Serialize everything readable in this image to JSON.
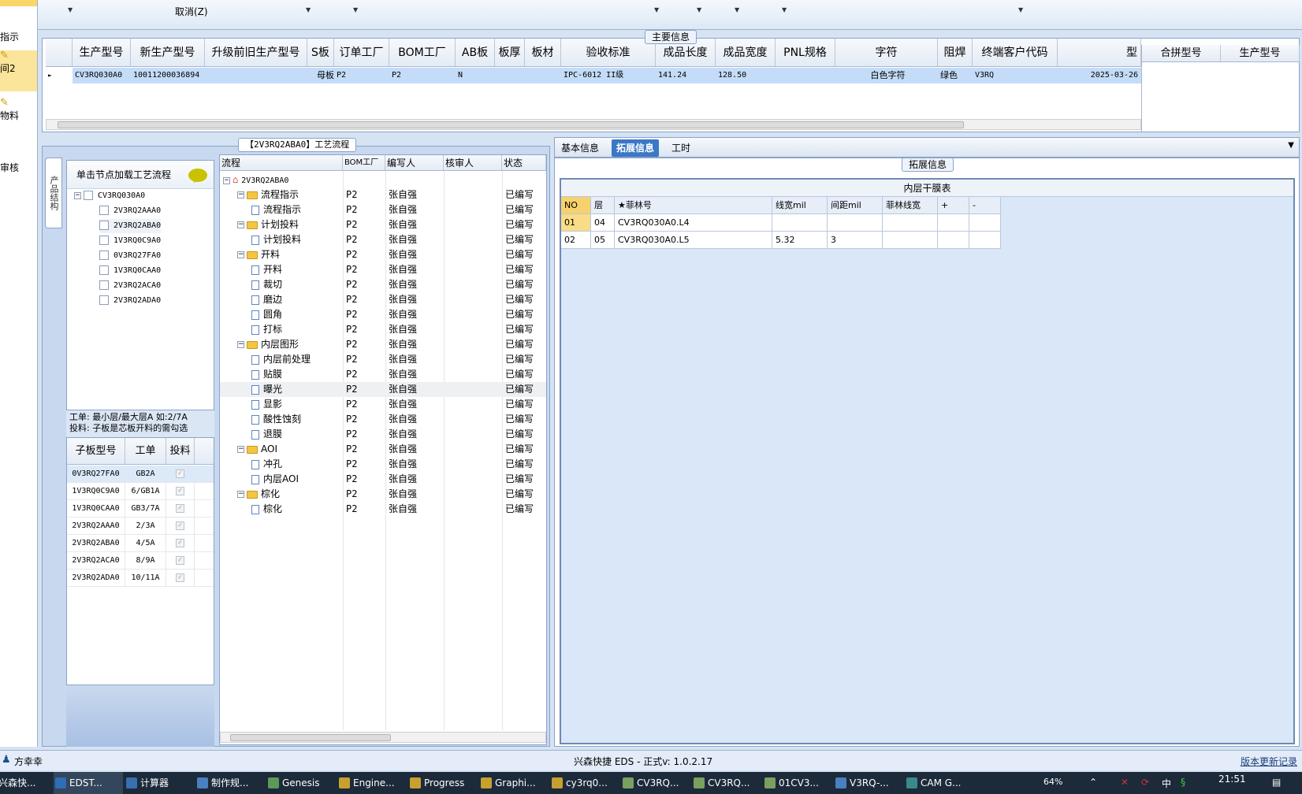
{
  "toolbar": {
    "cancel_label": "取消(Z)"
  },
  "left_nav": [
    "指示",
    "间2",
    "物料",
    "审核"
  ],
  "main_info": {
    "legend": "主要信息",
    "columns": [
      "生产型号",
      "新生产型号",
      "升级前旧生产型号",
      "S板",
      "订单工厂",
      "BOM工厂",
      "AB板",
      "板厚",
      "板材",
      "验收标准",
      "成品长度",
      "成品宽度",
      "PNL规格",
      "字符",
      "阻焊",
      "终端客户代码",
      "型"
    ],
    "row": [
      "CV3RQ030A0",
      "10011200036894",
      "",
      "母板",
      "P2",
      "P2",
      "N",
      "",
      "",
      "IPC-6012 II级",
      "141.24",
      "128.50",
      "",
      "白色字符",
      "绿色",
      "V3RQ",
      "2025-03-26"
    ],
    "side_columns": [
      "合拼型号",
      "生产型号"
    ]
  },
  "process": {
    "legend": "【2V3RQ2ABA0】工艺流程",
    "vtab": "产品结构",
    "tree_header": "单击节点加载工艺流程",
    "tree_root": "CV3RQ030A0",
    "tree_children": [
      "2V3RQ2AAA0",
      "2V3RQ2ABA0",
      "1V3RQ0C9A0",
      "0V3RQ27FA0",
      "1V3RQ0CAA0",
      "2V3RQ2ACA0",
      "2V3RQ2ADA0"
    ],
    "note_line1": "工单: 最小层/最大层A 如:2/7A",
    "note_line2": "投料: 子板是芯板开料的需勾选",
    "sub_columns": [
      "子板型号",
      "工单",
      "投料"
    ],
    "sub_rows": [
      [
        "0V3RQ27FA0",
        "GB2A",
        "✓"
      ],
      [
        "1V3RQ0C9A0",
        "6/GB1A",
        "✓"
      ],
      [
        "1V3RQ0CAA0",
        "GB3/7A",
        "✓"
      ],
      [
        "2V3RQ2AAA0",
        "2/3A",
        "✓"
      ],
      [
        "2V3RQ2ABA0",
        "4/5A",
        "✓"
      ],
      [
        "2V3RQ2ACA0",
        "8/9A",
        "✓"
      ],
      [
        "2V3RQ2ADA0",
        "10/11A",
        "✓"
      ]
    ],
    "flow_columns": [
      "流程",
      "BOM工厂",
      "编写人",
      "核审人",
      "状态"
    ],
    "flow_root": "2V3RQ2ABA0",
    "flow_rows": [
      {
        "level": 1,
        "type": "folder",
        "name": "流程指示",
        "bom": "P2",
        "author": "张自强",
        "status": "已编写"
      },
      {
        "level": 2,
        "type": "doc",
        "name": "流程指示",
        "bom": "P2",
        "author": "张自强",
        "status": "已编写"
      },
      {
        "level": 1,
        "type": "folder",
        "name": "计划投料",
        "bom": "P2",
        "author": "张自强",
        "status": "已编写"
      },
      {
        "level": 2,
        "type": "doc",
        "name": "计划投料",
        "bom": "P2",
        "author": "张自强",
        "status": "已编写"
      },
      {
        "level": 1,
        "type": "folder",
        "name": "开料",
        "bom": "P2",
        "author": "张自强",
        "status": "已编写"
      },
      {
        "level": 2,
        "type": "doc",
        "name": "开料",
        "bom": "P2",
        "author": "张自强",
        "status": "已编写"
      },
      {
        "level": 2,
        "type": "doc",
        "name": "裁切",
        "bom": "P2",
        "author": "张自强",
        "status": "已编写"
      },
      {
        "level": 2,
        "type": "doc",
        "name": "磨边",
        "bom": "P2",
        "author": "张自强",
        "status": "已编写"
      },
      {
        "level": 2,
        "type": "doc",
        "name": "圆角",
        "bom": "P2",
        "author": "张自强",
        "status": "已编写"
      },
      {
        "level": 2,
        "type": "doc",
        "name": "打标",
        "bom": "P2",
        "author": "张自强",
        "status": "已编写"
      },
      {
        "level": 1,
        "type": "folder",
        "name": "内层图形",
        "bom": "P2",
        "author": "张自强",
        "status": "已编写"
      },
      {
        "level": 2,
        "type": "doc",
        "name": "内层前处理",
        "bom": "P2",
        "author": "张自强",
        "status": "已编写"
      },
      {
        "level": 2,
        "type": "doc",
        "name": "贴膜",
        "bom": "P2",
        "author": "张自强",
        "status": "已编写"
      },
      {
        "level": 2,
        "type": "doc",
        "name": "曝光",
        "bom": "P2",
        "author": "张自强",
        "status": "已编写"
      },
      {
        "level": 2,
        "type": "doc",
        "name": "显影",
        "bom": "P2",
        "author": "张自强",
        "status": "已编写"
      },
      {
        "level": 2,
        "type": "doc",
        "name": "酸性蚀刻",
        "bom": "P2",
        "author": "张自强",
        "status": "已编写"
      },
      {
        "level": 2,
        "type": "doc",
        "name": "退膜",
        "bom": "P2",
        "author": "张自强",
        "status": "已编写"
      },
      {
        "level": 1,
        "type": "folder",
        "name": "AOI",
        "bom": "P2",
        "author": "张自强",
        "status": "已编写"
      },
      {
        "level": 2,
        "type": "doc",
        "name": "冲孔",
        "bom": "P2",
        "author": "张自强",
        "status": "已编写"
      },
      {
        "level": 2,
        "type": "doc",
        "name": "内层AOI",
        "bom": "P2",
        "author": "张自强",
        "status": "已编写"
      },
      {
        "level": 1,
        "type": "folder",
        "name": "棕化",
        "bom": "P2",
        "author": "张自强",
        "status": "已编写"
      },
      {
        "level": 2,
        "type": "doc",
        "name": "棕化",
        "bom": "P2",
        "author": "张自强",
        "status": "已编写"
      }
    ]
  },
  "extended": {
    "tabs": [
      "基本信息",
      "拓展信息",
      "工时"
    ],
    "active_tab": "拓展信息",
    "legend": "拓展信息",
    "table_title": "内层干膜表",
    "columns": [
      "NO",
      "层",
      "★菲林号",
      "线宽mil",
      "间距mil",
      "菲林线宽",
      "+",
      "-"
    ],
    "rows": [
      [
        "01",
        "04",
        "CV3RQ030A0.L4",
        "",
        "",
        "",
        "",
        ""
      ],
      [
        "02",
        "05",
        "CV3RQ030A0.L5",
        "5.32",
        "3",
        "",
        "",
        ""
      ]
    ]
  },
  "status_bar": {
    "user": "方幸幸",
    "app_version": "兴森快捷 EDS - 正式v: 1.0.2.17",
    "update_log": "版本更新记录"
  },
  "taskbar": {
    "items": [
      "兴森快...",
      "EDST...",
      "计算器",
      "制作规...",
      "Genesis",
      "Engine...",
      "Progress",
      "Graphi...",
      "cy3rq0...",
      "CV3RQ...",
      "CV3RQ...",
      "01CV3...",
      "V3RQ-...",
      "CAM G..."
    ],
    "battery": "64%",
    "ime": "中",
    "clock": "21:51"
  },
  "colors": {
    "selected_row": "#c4dcf7",
    "active_tab": "#3b78c6",
    "panel_bg": "#d6e3f3"
  }
}
